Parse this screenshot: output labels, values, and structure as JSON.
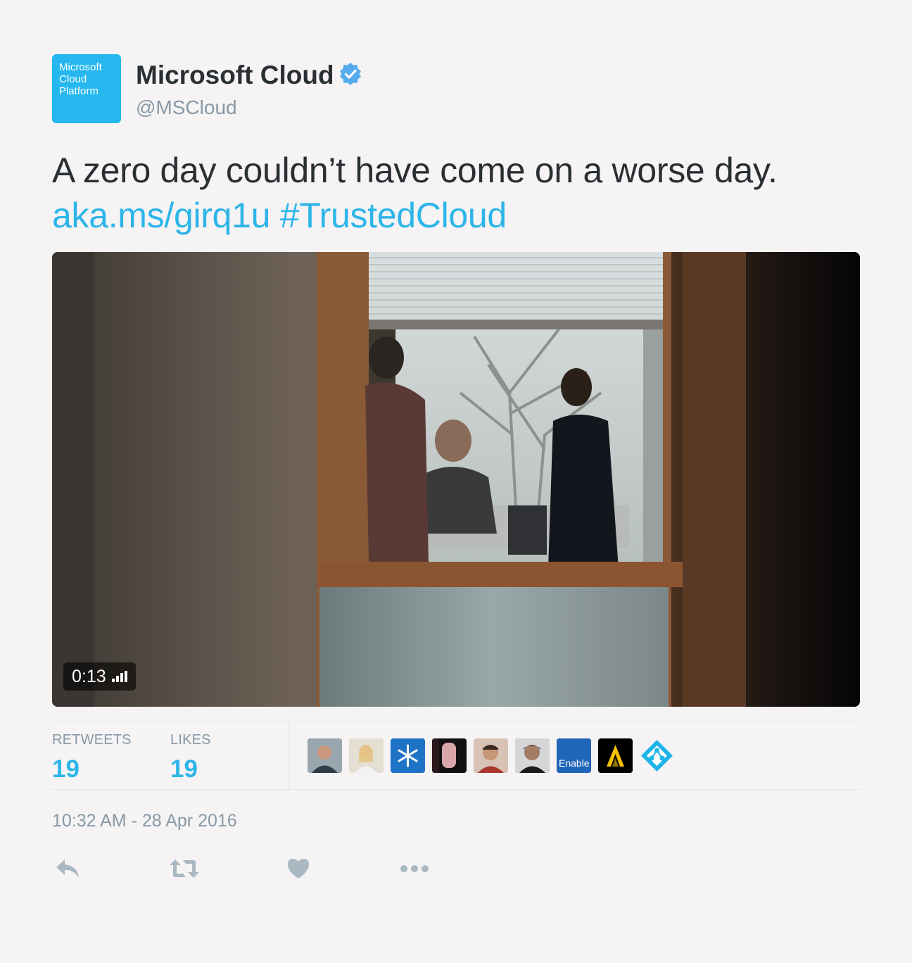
{
  "account": {
    "avatar_lines": [
      "Microsoft",
      "Cloud",
      "Platform"
    ],
    "display_name": "Microsoft Cloud",
    "handle": "@MSCloud",
    "verified": true
  },
  "tweet": {
    "text": "A zero day couldn’t have come on a worse day.",
    "link": "aka.ms/girq1u",
    "hashtag": "#TrustedCloud"
  },
  "media": {
    "type": "video",
    "duration": "0:13"
  },
  "stats": {
    "retweets_label": "RETWEETS",
    "retweets_count": "19",
    "likes_label": "LIKES",
    "likes_count": "19"
  },
  "likers": [
    {
      "name": "liker-1",
      "color": "#6e7b86"
    },
    {
      "name": "liker-2",
      "color": "#d9d2c4"
    },
    {
      "name": "liker-3",
      "color": "#1f73c6",
      "icon": "snowflake-icon"
    },
    {
      "name": "liker-4",
      "color": "#3a2a2c"
    },
    {
      "name": "liker-5",
      "color": "#b9937f"
    },
    {
      "name": "liker-6",
      "color": "#2d2d2d"
    },
    {
      "name": "liker-7",
      "color": "#1f65b8",
      "label": "Enable"
    },
    {
      "name": "liker-8",
      "color": "#000000",
      "icon": "chevron-a-icon"
    },
    {
      "name": "liker-9",
      "color": "#1fb4e8",
      "icon": "azure-ad-icon"
    }
  ],
  "timestamp": "10:32 AM - 28 Apr 2016",
  "actions": [
    "reply",
    "retweet",
    "like",
    "more"
  ],
  "colors": {
    "link": "#2cb5e8",
    "verified": "#55acee",
    "muted": "#8899a6",
    "icon": "#aab8c2"
  }
}
